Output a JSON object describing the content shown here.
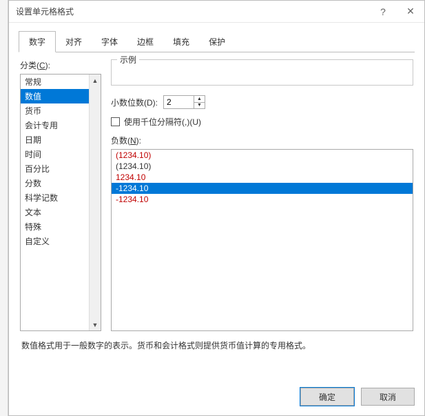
{
  "window": {
    "title": "设置单元格格式",
    "help": "?",
    "close": "✕"
  },
  "tabs": {
    "items": [
      {
        "label": "数字"
      },
      {
        "label": "对齐"
      },
      {
        "label": "字体"
      },
      {
        "label": "边框"
      },
      {
        "label": "填充"
      },
      {
        "label": "保护"
      }
    ],
    "active": 0
  },
  "category": {
    "label_prefix": "分类(",
    "label_u": "C",
    "label_suffix": "):",
    "items": [
      "常规",
      "数值",
      "货币",
      "会计专用",
      "日期",
      "时间",
      "百分比",
      "分数",
      "科学记数",
      "文本",
      "特殊",
      "自定义"
    ],
    "selected_index": 1
  },
  "sample": {
    "label": "示例",
    "value": ""
  },
  "decimals": {
    "label_prefix": "小数位数(",
    "label_u": "D",
    "label_suffix": "):",
    "value": "2"
  },
  "thousands": {
    "label_prefix": "使用千位分隔符(,)(",
    "label_u": "U",
    "label_suffix": ")",
    "checked": false
  },
  "negatives": {
    "label_prefix": "负数(",
    "label_u": "N",
    "label_suffix": "):",
    "items": [
      {
        "text": "(1234.10)",
        "red": true
      },
      {
        "text": "(1234.10)",
        "red": false
      },
      {
        "text": "1234.10",
        "red": true
      },
      {
        "text": "-1234.10",
        "red": false
      },
      {
        "text": "-1234.10",
        "red": true
      }
    ],
    "selected_index": 3
  },
  "description": "数值格式用于一般数字的表示。货币和会计格式则提供货币值计算的专用格式。",
  "buttons": {
    "ok": "确定",
    "cancel": "取消"
  }
}
